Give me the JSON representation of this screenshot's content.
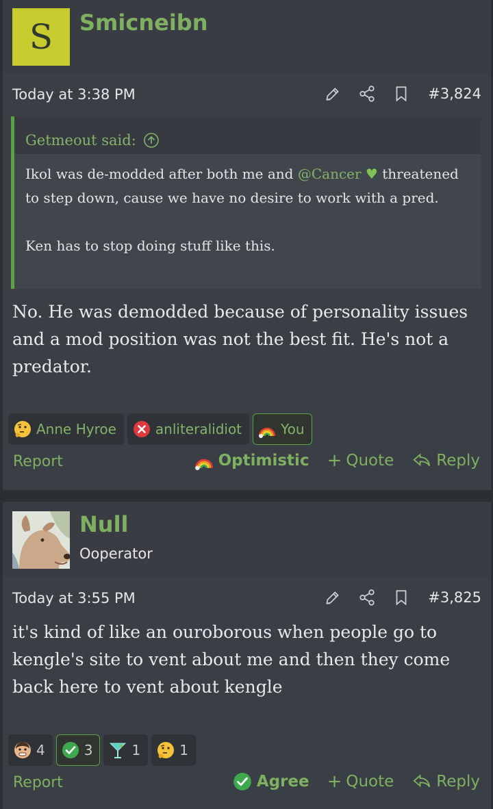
{
  "posts": [
    {
      "user": {
        "initial": "S",
        "name": "Smicneibn"
      },
      "date": "Today at 3:38 PM",
      "number": "#3,824",
      "quote": {
        "author": "Getmeout said:",
        "line1": "Ikol was de-modded after both me and ",
        "mention": "@Cancer",
        "heart": "♥",
        "line2": "threatened to step down, cause we have no desire to work with a pred.",
        "line3": "Ken has to stop doing stuff like this."
      },
      "message": "No. He was demodded because of personality issues and a mod position was not the best fit. He's not a predator.",
      "reactions": [
        {
          "emoji": "thinking-face",
          "label": "Anne Hyroe"
        },
        {
          "emoji": "red-x",
          "label": "anliteralidiot"
        },
        {
          "emoji": "rainbow",
          "label": "You"
        }
      ],
      "actions": {
        "report": "Report",
        "reaction": "Optimistic",
        "quote": "Quote",
        "reply": "Reply"
      }
    },
    {
      "user": {
        "name": "Null",
        "title": "Ooperator"
      },
      "date": "Today at 3:55 PM",
      "number": "#3,825",
      "message": "it's kind of like an ouroborous when people go to kengle's site to vent about me and then they come back here to vent about kengle",
      "reactions": [
        {
          "emoji": "face",
          "count": "4"
        },
        {
          "emoji": "check",
          "count": "3"
        },
        {
          "emoji": "cocktail",
          "count": "1"
        },
        {
          "emoji": "thinking-face",
          "count": "1"
        }
      ],
      "actions": {
        "report": "Report",
        "reaction": "Agree",
        "quote": "Quote",
        "reply": "Reply"
      }
    }
  ],
  "colors": {
    "accent": "#7fb061",
    "quote_border": "#5aa343",
    "post_bg": "#3a3e45"
  }
}
